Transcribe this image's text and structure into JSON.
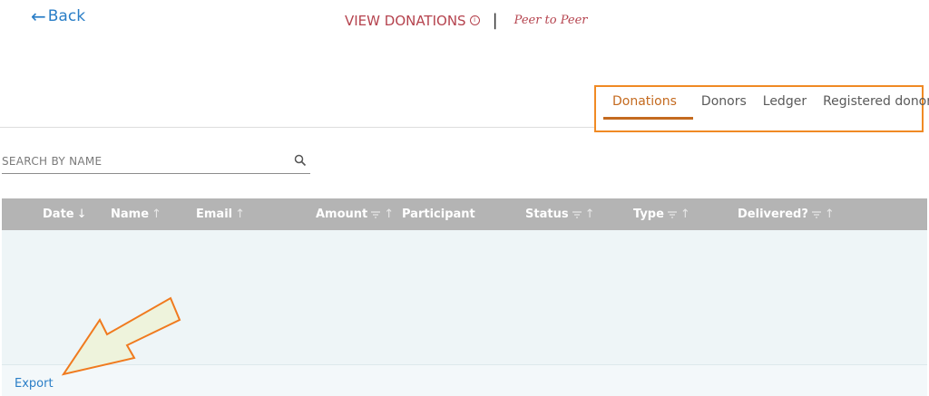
{
  "header": {
    "back_label": "Back",
    "title": "VIEW DONATIONS",
    "separator": "|",
    "subtitle": "Peer to Peer"
  },
  "tabs": [
    {
      "label": "Donations",
      "active": true
    },
    {
      "label": "Donors",
      "active": false
    },
    {
      "label": "Ledger",
      "active": false
    },
    {
      "label": "Registered donors",
      "active": false
    }
  ],
  "search": {
    "placeholder": "SEARCH BY NAME",
    "value": ""
  },
  "table": {
    "columns": [
      {
        "label": "Date",
        "sort": "↓"
      },
      {
        "label": "Name",
        "sort": "↑"
      },
      {
        "label": "Email",
        "sort": "↑"
      },
      {
        "label": "Amount",
        "sort": "↑"
      },
      {
        "label": "Participant",
        "sort": ""
      },
      {
        "label": "Status",
        "sort": "↑"
      },
      {
        "label": "Type",
        "sort": "↑"
      },
      {
        "label": "Delivered?",
        "sort": "↑"
      }
    ],
    "rows": []
  },
  "footer": {
    "export_label": "Export"
  },
  "colors": {
    "link": "#2a7ec7",
    "title": "#b5434e",
    "active_tab": "#c46a1f",
    "highlight_box": "#f08a24",
    "table_header_bg": "#b4b4b4",
    "table_body_bg": "#eef5f7"
  },
  "icons": {
    "back": "arrow-left-icon",
    "info": "info-icon",
    "search": "search-icon",
    "filter": "filter-icon"
  }
}
